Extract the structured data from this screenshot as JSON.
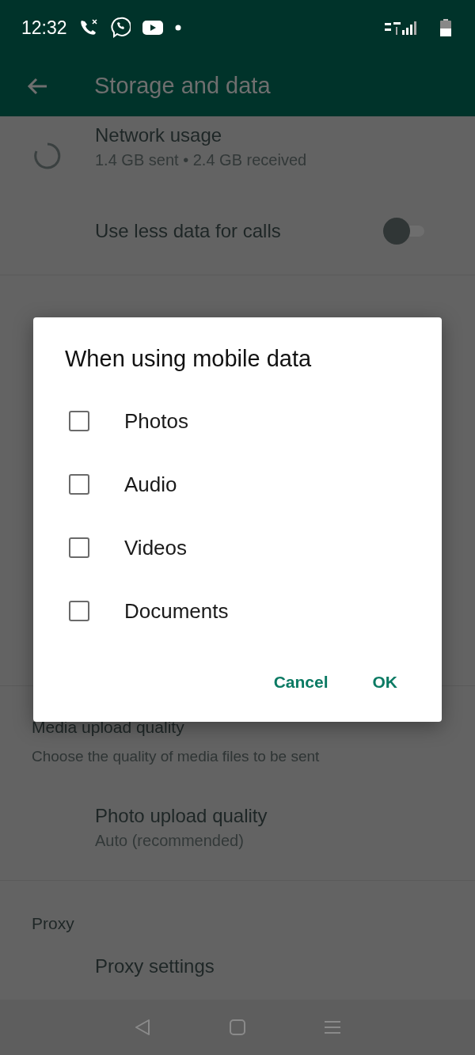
{
  "status_bar": {
    "time": "12:32"
  },
  "app_bar": {
    "title": "Storage and data"
  },
  "network_usage": {
    "title": "Network usage",
    "subtitle": "1.4 GB sent • 2.4 GB received"
  },
  "less_data_calls": {
    "label": "Use less data for calls",
    "on": false
  },
  "media_upload": {
    "title": "Media upload quality",
    "subtitle": "Choose the quality of media files to be sent"
  },
  "photo_upload": {
    "title": "Photo upload quality",
    "subtitle": "Auto (recommended)"
  },
  "proxy": {
    "title": "Proxy",
    "item": "Proxy settings"
  },
  "dialog": {
    "title": "When using mobile data",
    "options": [
      {
        "label": "Photos",
        "checked": false
      },
      {
        "label": "Audio",
        "checked": false
      },
      {
        "label": "Videos",
        "checked": false
      },
      {
        "label": "Documents",
        "checked": false
      }
    ],
    "buttons": [
      "Cancel",
      "OK"
    ]
  }
}
